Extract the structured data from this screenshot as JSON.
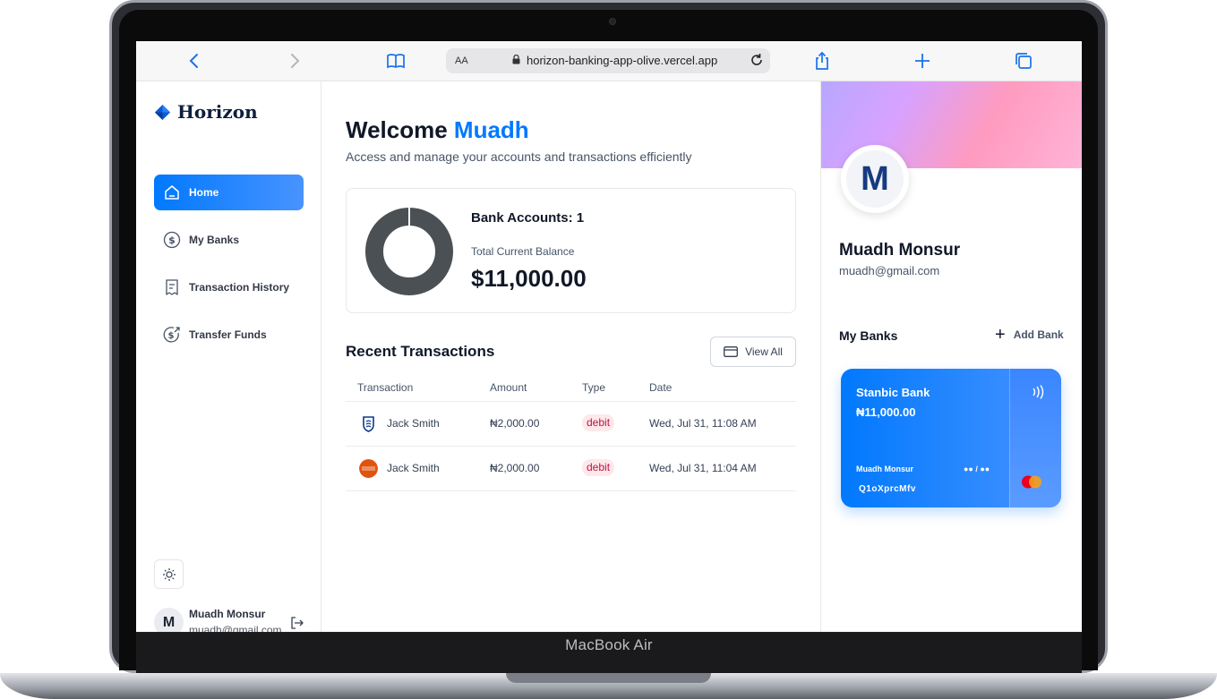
{
  "device": {
    "model_label": "MacBook Air"
  },
  "browser": {
    "text_size_label": "AA",
    "url": "horizon-banking-app-olive.vercel.app"
  },
  "sidebar": {
    "logo_text": "Horizon",
    "items": [
      {
        "label": "Home",
        "icon": "home-icon",
        "active": true
      },
      {
        "label": "My Banks",
        "icon": "dollar-circle-icon",
        "active": false
      },
      {
        "label": "Transaction History",
        "icon": "receipt-icon",
        "active": false
      },
      {
        "label": "Transfer Funds",
        "icon": "money-send-icon",
        "active": false
      }
    ],
    "theme_icon": "sun-icon",
    "user": {
      "initial": "M",
      "name": "Muadh Monsur",
      "email": "muadh@gmail.com"
    }
  },
  "main": {
    "welcome_prefix": "Welcome",
    "welcome_name": "Muadh",
    "subtitle": "Access and manage your accounts and transactions efficiently",
    "balance": {
      "accounts_label": "Bank Accounts: 1",
      "total_label": "Total Current Balance",
      "total_value": "$11,000.00",
      "donut_share": 1.0
    },
    "recent": {
      "title": "Recent Transactions",
      "view_all_label": "View All",
      "columns": [
        "Transaction",
        "Amount",
        "Type",
        "Date"
      ],
      "rows": [
        {
          "name": "Jack Smith",
          "amount": "₦2,000.00",
          "type": "debit",
          "date": "Wed, Jul 31, 11:08 AM",
          "logo_color": "#0b3a8c"
        },
        {
          "name": "Jack Smith",
          "amount": "₦2,000.00",
          "type": "debit",
          "date": "Wed, Jul 31, 11:04 AM",
          "logo_color": "#e0530f"
        }
      ]
    }
  },
  "right": {
    "initial": "M",
    "name": "Muadh Monsur",
    "email": "muadh@gmail.com",
    "my_banks_label": "My Banks",
    "add_bank_label": "Add Bank",
    "card": {
      "bank": "Stanbic Bank",
      "balance": "₦11,000.00",
      "owner": "Muadh Monsur",
      "expiry": "●● / ●●",
      "mask": "Q1oXprcMfv"
    }
  },
  "colors": {
    "accent": "#0179fe",
    "debit_bg": "#fde8ea",
    "debit_text": "#c01048"
  }
}
